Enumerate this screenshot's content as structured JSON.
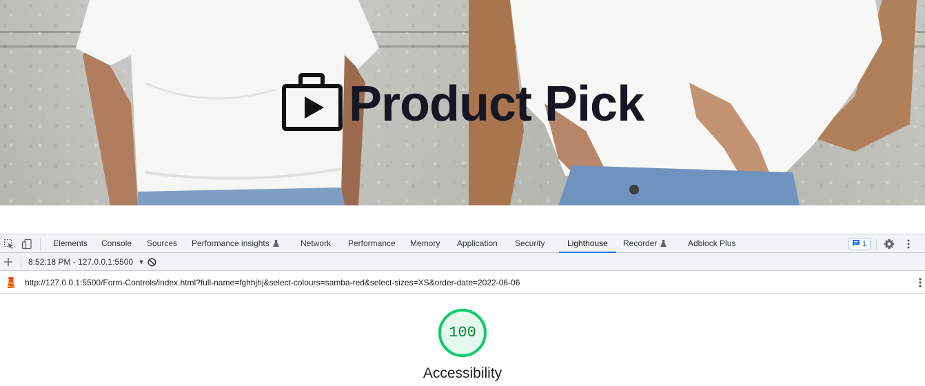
{
  "hero": {
    "title": "Product Pick",
    "logo_icon": "briefcase-play-icon"
  },
  "devtools": {
    "toolbar_icons": [
      "inspect-element-icon",
      "device-toolbar-icon"
    ],
    "tabs": [
      {
        "label": "Elements"
      },
      {
        "label": "Console"
      },
      {
        "label": "Sources"
      },
      {
        "label": "Performance insights",
        "experimental": true
      },
      {
        "label": "Network"
      },
      {
        "label": "Performance"
      },
      {
        "label": "Memory"
      },
      {
        "label": "Application"
      },
      {
        "label": "Security"
      },
      {
        "label": "Lighthouse",
        "active": true
      },
      {
        "label": "Recorder",
        "experimental": true
      },
      {
        "label": "Adblock Plus"
      }
    ],
    "issues_count": "1",
    "accent_color": "#1a73e8",
    "lighthouse": {
      "report_select": "8:52:18 PM - 127.0.0.1:5500",
      "url": "http://127.0.0.1:5500/Form-Controls/index.html?full-name=fghhjhj&select-colours=samba-red&select-sizes=XS&order-date=2022-06-06",
      "score": "100",
      "score_fraction": 1.0,
      "category": "Accessibility",
      "score_color": "#0cce6b"
    }
  }
}
